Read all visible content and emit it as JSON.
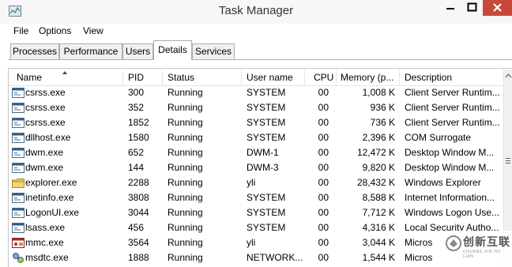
{
  "window": {
    "title": "Task Manager"
  },
  "menu": [
    "File",
    "Options",
    "View"
  ],
  "tabs": [
    {
      "label": "Processes",
      "active": false
    },
    {
      "label": "Performance",
      "active": false
    },
    {
      "label": "Users",
      "active": false
    },
    {
      "label": "Details",
      "active": true
    },
    {
      "label": "Services",
      "active": false
    }
  ],
  "columns": {
    "name": "Name",
    "pid": "PID",
    "status": "Status",
    "user": "User name",
    "cpu": "CPU",
    "memory": "Memory (p...",
    "description": "Description"
  },
  "rows": [
    {
      "icon": "console-app-icon",
      "name": "csrss.exe",
      "pid": "300",
      "status": "Running",
      "user": "SYSTEM",
      "cpu": "00",
      "memory": "1,008 K",
      "description": "Client Server Runtim..."
    },
    {
      "icon": "console-app-icon",
      "name": "csrss.exe",
      "pid": "352",
      "status": "Running",
      "user": "SYSTEM",
      "cpu": "00",
      "memory": "936 K",
      "description": "Client Server Runtim..."
    },
    {
      "icon": "console-app-icon",
      "name": "csrss.exe",
      "pid": "1852",
      "status": "Running",
      "user": "SYSTEM",
      "cpu": "00",
      "memory": "736 K",
      "description": "Client Server Runtim..."
    },
    {
      "icon": "console-app-icon",
      "name": "dllhost.exe",
      "pid": "1580",
      "status": "Running",
      "user": "SYSTEM",
      "cpu": "00",
      "memory": "2,396 K",
      "description": "COM Surrogate"
    },
    {
      "icon": "console-app-icon",
      "name": "dwm.exe",
      "pid": "652",
      "status": "Running",
      "user": "DWM-1",
      "cpu": "00",
      "memory": "12,472 K",
      "description": "Desktop Window M..."
    },
    {
      "icon": "console-app-icon",
      "name": "dwm.exe",
      "pid": "144",
      "status": "Running",
      "user": "DWM-3",
      "cpu": "00",
      "memory": "9,820 K",
      "description": "Desktop Window M..."
    },
    {
      "icon": "folder-icon",
      "name": "explorer.exe",
      "pid": "2288",
      "status": "Running",
      "user": "yli",
      "cpu": "00",
      "memory": "28,432 K",
      "description": "Windows Explorer"
    },
    {
      "icon": "console-app-icon",
      "name": "inetinfo.exe",
      "pid": "3808",
      "status": "Running",
      "user": "SYSTEM",
      "cpu": "00",
      "memory": "8,588 K",
      "description": "Internet Information..."
    },
    {
      "icon": "console-app-icon",
      "name": "LogonUI.exe",
      "pid": "3044",
      "status": "Running",
      "user": "SYSTEM",
      "cpu": "00",
      "memory": "7,712 K",
      "description": "Windows Logon Use..."
    },
    {
      "icon": "console-app-icon",
      "name": "lsass.exe",
      "pid": "456",
      "status": "Running",
      "user": "SYSTEM",
      "cpu": "00",
      "memory": "4,316 K",
      "description": "Local Security Autho..."
    },
    {
      "icon": "mmc-icon",
      "name": "mmc.exe",
      "pid": "3564",
      "status": "Running",
      "user": "yli",
      "cpu": "00",
      "memory": "3,044 K",
      "description": "Micros"
    },
    {
      "icon": "network-service-icon",
      "name": "msdtc.exe",
      "pid": "1888",
      "status": "Running",
      "user": "NETWORK...",
      "cpu": "00",
      "memory": "1,544 K",
      "description": "Micros"
    }
  ],
  "watermark": {
    "text": "创新互联",
    "sub": "CHUANG XIN HU LIAN"
  },
  "colors": {
    "close_button": "#c7483b",
    "tab_border": "#adadad",
    "header_divider": "#e5e5e5"
  }
}
